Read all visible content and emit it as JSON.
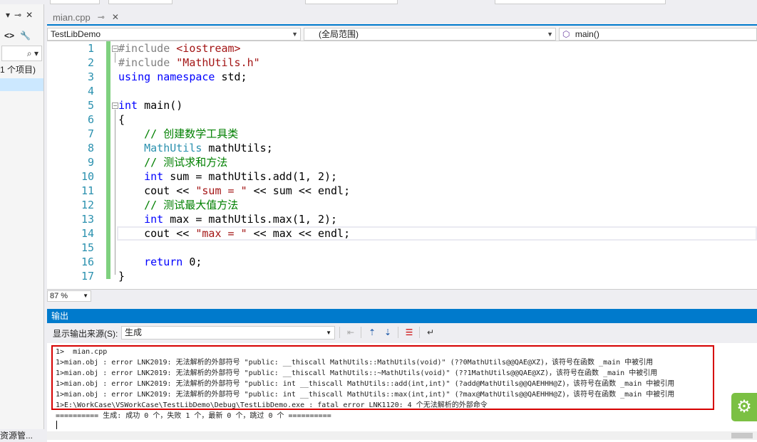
{
  "left_panel": {
    "pin_icons": [
      "▾",
      "📌",
      "✕"
    ],
    "search_icon": "⌕",
    "project_label": "1 个项目)",
    "bottom_tab": "资源管..."
  },
  "tab": {
    "title": "mian.cpp",
    "pin": "⊸",
    "close": "✕"
  },
  "nav": {
    "project": "TestLibDemo",
    "scope": "(全局范围)",
    "function": "main()"
  },
  "editor": {
    "line_numbers": [
      "1",
      "2",
      "3",
      "4",
      "5",
      "6",
      "7",
      "8",
      "9",
      "10",
      "11",
      "12",
      "13",
      "14",
      "15",
      "16",
      "17"
    ],
    "lines": [
      [
        {
          "t": "pp",
          "v": "#include "
        },
        {
          "t": "str",
          "v": "<iostream>"
        }
      ],
      [
        {
          "t": "pp",
          "v": "#include "
        },
        {
          "t": "str",
          "v": "\"MathUtils.h\""
        }
      ],
      [
        {
          "t": "kw",
          "v": "using"
        },
        {
          "t": "tx",
          "v": " "
        },
        {
          "t": "kw",
          "v": "namespace"
        },
        {
          "t": "tx",
          "v": " std;"
        }
      ],
      [],
      [
        {
          "t": "kw",
          "v": "int"
        },
        {
          "t": "tx",
          "v": " main()"
        }
      ],
      [
        {
          "t": "tx",
          "v": "{"
        }
      ],
      [
        {
          "t": "tx",
          "v": "    "
        },
        {
          "t": "cm",
          "v": "// 创建数学工具类"
        }
      ],
      [
        {
          "t": "tx",
          "v": "    "
        },
        {
          "t": "ty",
          "v": "MathUtils"
        },
        {
          "t": "tx",
          "v": " mathUtils;"
        }
      ],
      [
        {
          "t": "tx",
          "v": "    "
        },
        {
          "t": "cm",
          "v": "// 测试求和方法"
        }
      ],
      [
        {
          "t": "tx",
          "v": "    "
        },
        {
          "t": "kw",
          "v": "int"
        },
        {
          "t": "tx",
          "v": " sum = mathUtils.add(1, 2);"
        }
      ],
      [
        {
          "t": "tx",
          "v": "    cout << "
        },
        {
          "t": "str",
          "v": "\"sum = \""
        },
        {
          "t": "tx",
          "v": " << sum << endl;"
        }
      ],
      [
        {
          "t": "tx",
          "v": "    "
        },
        {
          "t": "cm",
          "v": "// 测试最大值方法"
        }
      ],
      [
        {
          "t": "tx",
          "v": "    "
        },
        {
          "t": "kw",
          "v": "int"
        },
        {
          "t": "tx",
          "v": " max = mathUtils.max(1, 2);"
        }
      ],
      [
        {
          "t": "tx",
          "v": "    cout << "
        },
        {
          "t": "str",
          "v": "\"max = \""
        },
        {
          "t": "tx",
          "v": " << max << endl;"
        }
      ],
      [],
      [
        {
          "t": "tx",
          "v": "    "
        },
        {
          "t": "kw",
          "v": "return"
        },
        {
          "t": "tx",
          "v": " 0;"
        }
      ],
      [
        {
          "t": "tx",
          "v": "}"
        }
      ]
    ]
  },
  "zoom": "87 %",
  "output": {
    "title": "输出",
    "source_label": "显示输出来源(S):",
    "source_value": "生成",
    "lines": [
      "1>  mian.cpp",
      "1>mian.obj : error LNK2019: 无法解析的外部符号 \"public: __thiscall MathUtils::MathUtils(void)\" (??0MathUtils@@QAE@XZ)，该符号在函数 _main 中被引用",
      "1>mian.obj : error LNK2019: 无法解析的外部符号 \"public: __thiscall MathUtils::~MathUtils(void)\" (??1MathUtils@@QAE@XZ)，该符号在函数 _main 中被引用",
      "1>mian.obj : error LNK2019: 无法解析的外部符号 \"public: int __thiscall MathUtils::add(int,int)\" (?add@MathUtils@@QAEHHH@Z)，该符号在函数 _main 中被引用",
      "1>mian.obj : error LNK2019: 无法解析的外部符号 \"public: int __thiscall MathUtils::max(int,int)\" (?max@MathUtils@@QAEHHH@Z)，该符号在函数 _main 中被引用",
      "1>E:\\WorkCase\\VSWorkCase\\TestLibDemo\\Debug\\TestLibDemo.exe : fatal error LNK1120: 4 个无法解析的外部命令",
      "========== 生成: 成功 0 个，失败 1 个，最新 0 个，跳过 0 个 =========="
    ]
  },
  "colors": {
    "accent": "#007acc",
    "error_box": "#d60000",
    "selection_margin": "#7fd07f"
  }
}
